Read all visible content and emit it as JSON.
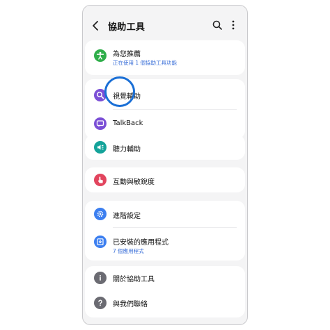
{
  "header": {
    "title": "協助工具"
  },
  "sections": {
    "recommended": {
      "label": "為您推薦",
      "sub": "正在使用 1 個協助工具功能",
      "icon": "accessibility-person-icon",
      "color": "#2fae4a"
    },
    "vision": {
      "label": "視覺輔助",
      "icon": "magnifier-icon",
      "color": "#7b4fd6"
    },
    "talkback": {
      "label": "TalkBack",
      "icon": "speech-bubble-icon",
      "color": "#7b4fd6"
    },
    "hearing": {
      "label": "聽力輔助",
      "icon": "hearing-icon",
      "color": "#14a39a"
    },
    "interaction": {
      "label": "互動與敏銳度",
      "icon": "touch-hand-icon",
      "color": "#e2455e"
    },
    "advanced": {
      "label": "進階設定",
      "icon": "gear-icon",
      "color": "#3c7ff0"
    },
    "installed": {
      "label": "已安裝的應用程式",
      "sub": "7 個應用程式",
      "icon": "download-icon",
      "color": "#3c7ff0"
    },
    "about": {
      "label": "關於協助工具",
      "icon": "info-icon",
      "color": "#6b6b72"
    },
    "contact": {
      "label": "與我們聯絡",
      "icon": "help-question-icon",
      "color": "#6b6b72"
    }
  }
}
